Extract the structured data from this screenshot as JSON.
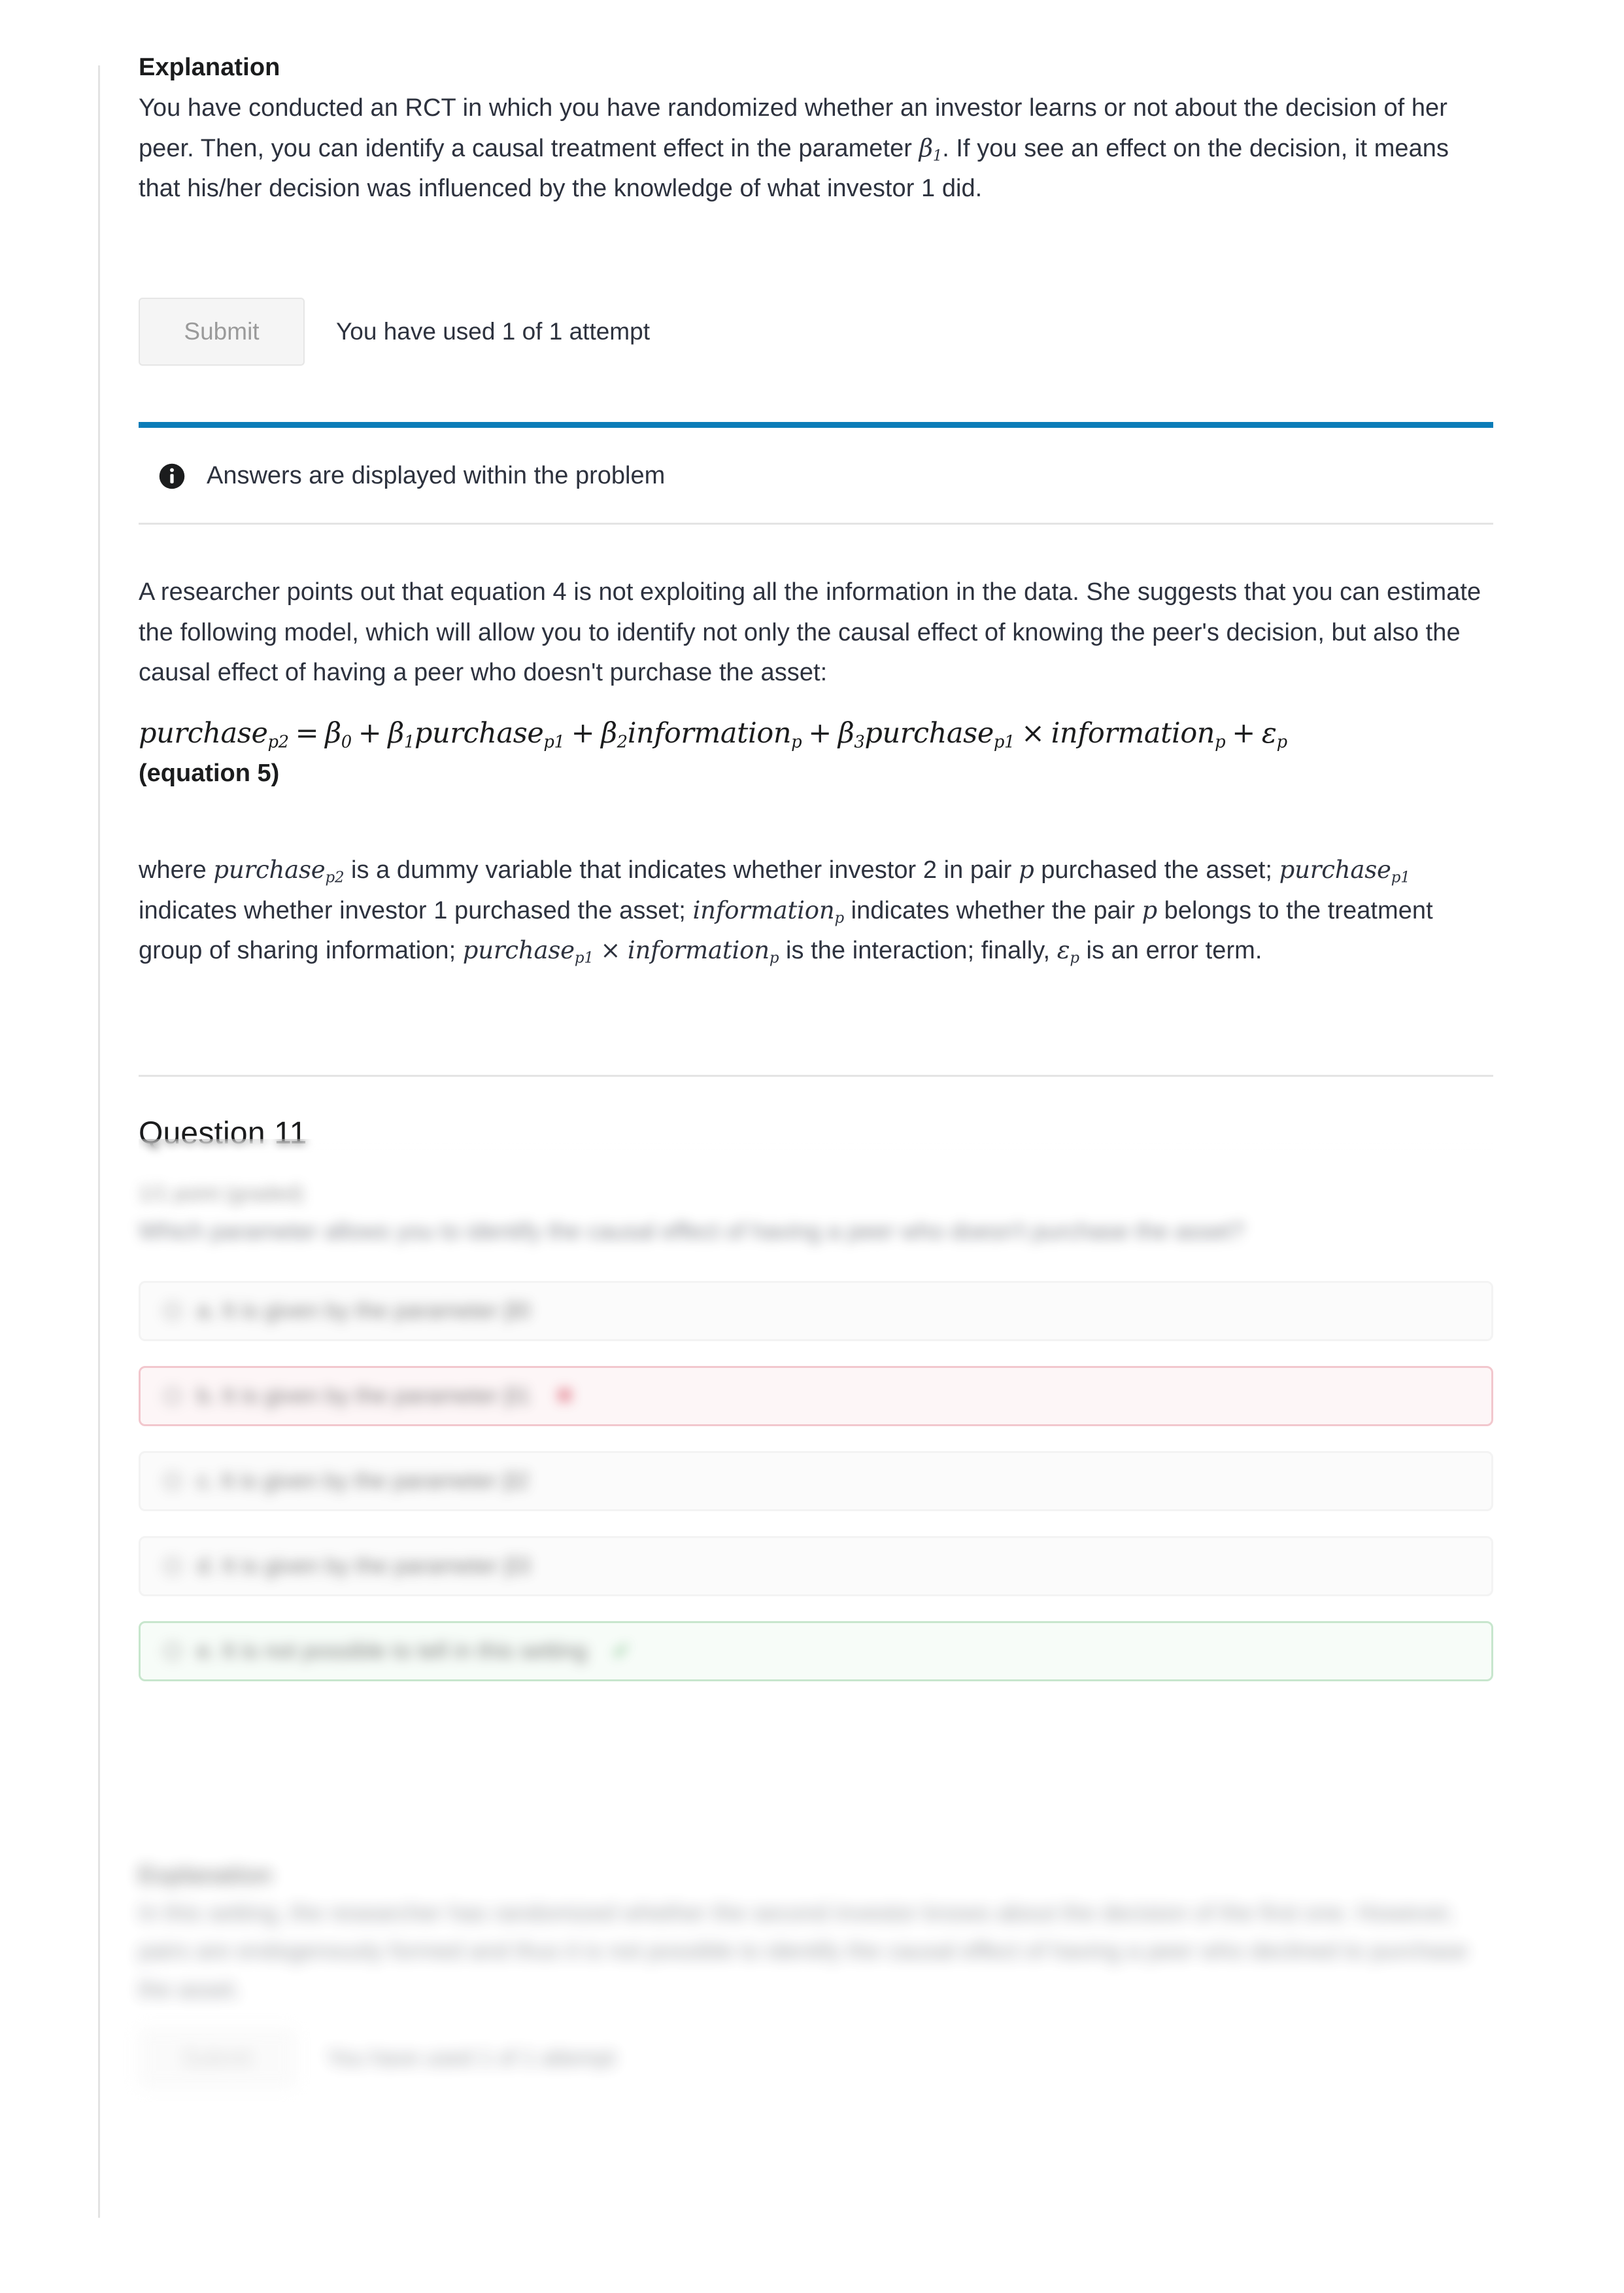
{
  "theme": {
    "accent_blue": "#0b7cb8",
    "incorrect_border": "#f2c7cd",
    "incorrect_bg": "#fdf6f7",
    "correct_border": "#c7e6cd",
    "correct_bg": "#f7fcf8",
    "rule_gray": "#e4e4e4",
    "text": "#2d323e"
  },
  "explanation": {
    "heading": "Explanation",
    "body": "You have conducted an RCT in which you have randomized whether an investor learns or not about the decision of her peer. Then, you can identify a causal treatment effect in the parameter ",
    "body_math": "β₁",
    "body_cont": ". If you see an effect on the decision, it means that his/her decision was influenced by the knowledge of what investor 1 did."
  },
  "submit_row": {
    "button_label": "Submit",
    "attempt_text": "You have used 1 of 1 attempt"
  },
  "status": {
    "icon": "info-icon",
    "text": "Answers are displayed within the problem"
  },
  "researcher_note": {
    "body": "A researcher points out that equation 4 is not exploiting all the information in the data. She suggests that you can estimate the following model, which will allow you to identify not only the causal effect of knowing the peer's decision, but also the causal effect of having a peer who doesn't purchase the asset:"
  },
  "equation": {
    "lhs_var": "purchase",
    "lhs_sub": "p2",
    "eq": "=",
    "b0": "β",
    "b0_sub": "0",
    "plus": "+",
    "b1": "β",
    "b1_sub": "1",
    "t1_var": "purchase",
    "t1_sub": "p1",
    "b2": "β",
    "b2_sub": "2",
    "t2_var": "information",
    "t2_sub": "p",
    "b3": "β",
    "b3_sub": "3",
    "t3_var": "purchase",
    "t3_sub": "p1",
    "times": "×",
    "t4_var": "information",
    "t4_sub": "p",
    "eps": "ε",
    "eps_sub": "p",
    "label": "(equation 5)"
  },
  "definitions": {
    "seg1": "where ",
    "m1": "purchase",
    "m1_sub": "p2",
    "seg2": " is a dummy variable that indicates whether investor 2 in pair ",
    "m2": "p",
    "seg3": " purchased the asset; ",
    "m3": "purchase",
    "m3_sub": "p1",
    "seg4": " indicates whether investor 1 purchased the asset;  ",
    "m4": "information",
    "m4_sub": "p",
    "seg5": " indicates whether the pair ",
    "m5": "p",
    "seg6": " belongs to the treatment group of sharing information; ",
    "m6": "purchase",
    "m6_sub": "p1",
    "m6b": "×",
    "m7": "information",
    "m7_sub": "p",
    "seg7": " is the interaction; finally, ",
    "m8": "ε",
    "m8_sub": "p",
    "seg8": " is an error term."
  },
  "question11": {
    "title": "Question 11",
    "points": "1/1 point (graded)",
    "prompt": "Which parameter allows you to identify the causal effect of having a peer who doesn't purchase the asset?",
    "choices": [
      {
        "label": "a. It is given by the parameter β0",
        "state": "neutral",
        "mark": ""
      },
      {
        "label": "b. It is given by the parameter β1",
        "state": "incorrect",
        "mark": "✖"
      },
      {
        "label": "c. It is given by the parameter β2",
        "state": "neutral",
        "mark": ""
      },
      {
        "label": "d. It is given by the parameter β3",
        "state": "neutral",
        "mark": ""
      },
      {
        "label": "e. It is not possible to tell in this setting",
        "state": "correct",
        "mark": "✔"
      }
    ],
    "explanation_heading": "Explanation",
    "explanation_body": "In this setting, the researcher has randomized whether the second investor knows about the decision of the first one. However, pairs are endogenously formed and thus it is not possible to identify the causal effect of having a peer who declined to purchase the asset.",
    "submit_label": "Submit",
    "attempt_text": "You have used 1 of 1 attempt"
  }
}
